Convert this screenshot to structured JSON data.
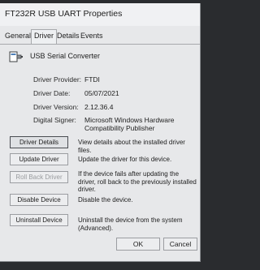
{
  "window": {
    "title": "FT232R USB UART Properties"
  },
  "tabs": [
    {
      "label": "General"
    },
    {
      "label": "Driver"
    },
    {
      "label": "Details"
    },
    {
      "label": "Events"
    }
  ],
  "device": {
    "name": "USB Serial Converter",
    "icon": "usb-device-icon"
  },
  "driver_info": {
    "provider": {
      "label": "Driver Provider:",
      "value": "FTDI"
    },
    "date": {
      "label": "Driver Date:",
      "value": "05/07/2021"
    },
    "version": {
      "label": "Driver Version:",
      "value": "2.12.36.4"
    },
    "signer": {
      "label": "Digital Signer:",
      "value": "Microsoft Windows Hardware Compatibility Publisher"
    }
  },
  "actions": [
    {
      "label": "Driver Details",
      "description": "View details about the installed driver files."
    },
    {
      "label": "Update Driver",
      "description": "Update the driver for this device."
    },
    {
      "label": "Roll Back Driver",
      "description": "If the device fails after updating the driver, roll back to the previously installed driver."
    },
    {
      "label": "Disable Device",
      "description": "Disable the device."
    },
    {
      "label": "Uninstall Device",
      "description": "Uninstall the device from the system (Advanced)."
    }
  ],
  "footer": {
    "ok": "OK",
    "cancel": "Cancel"
  }
}
